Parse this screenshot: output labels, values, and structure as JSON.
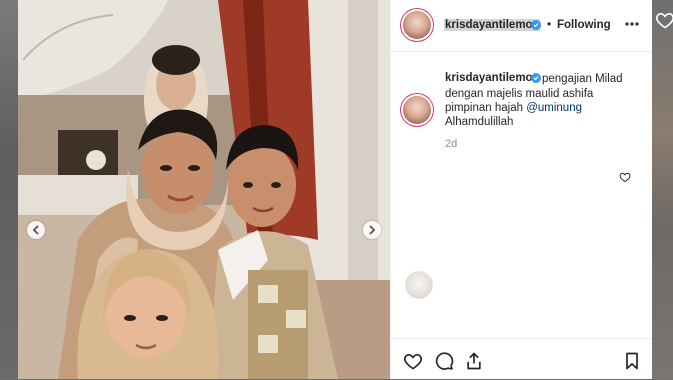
{
  "post": {
    "username": "krisdayantilemos",
    "follow_state": "Following",
    "dot": "•",
    "caption": {
      "username": "krisdayantilemos",
      "line1": "pengajian Milad",
      "line2": "dengan majelis maulid ashifa",
      "line3_prefix": "pimpinan hajah ",
      "mention": "@uminung",
      "line4": "Alhamdulillah"
    },
    "timestamp": "2d"
  },
  "icons": {
    "verified": "verified-badge-icon",
    "more": "more-options-icon",
    "like": "heart-icon",
    "comment": "comment-icon",
    "share": "share-icon",
    "save": "bookmark-icon",
    "prev": "chevron-left-icon",
    "next": "chevron-right-icon"
  },
  "colors": {
    "verified": "#3897f0",
    "text": "#262626",
    "secondary": "#8e8e8e",
    "mention": "#003569"
  }
}
